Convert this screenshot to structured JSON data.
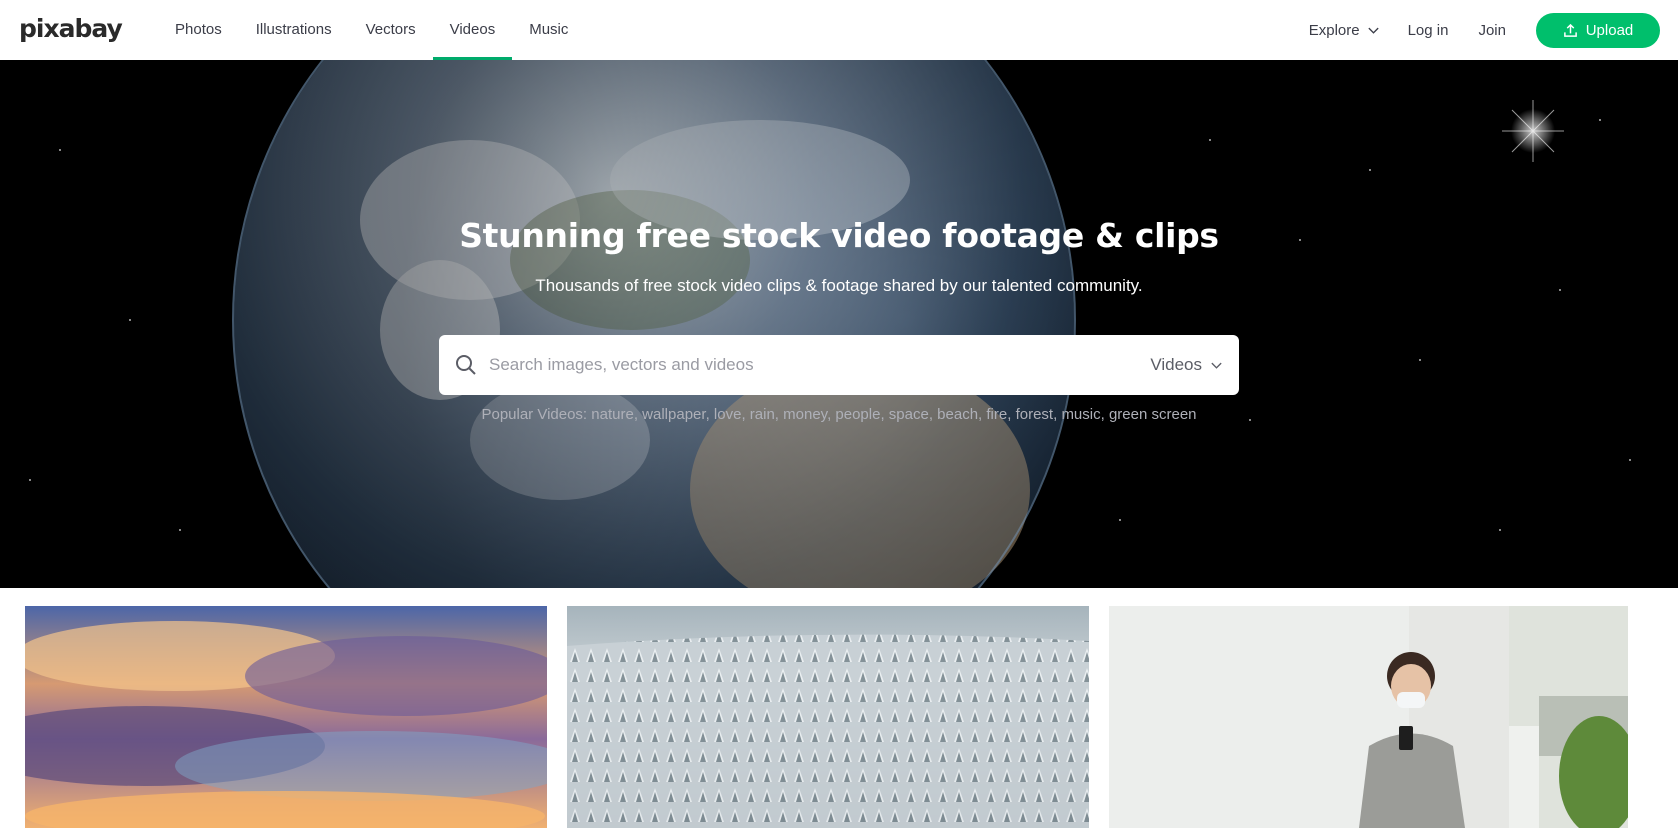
{
  "logo": "pixabay",
  "nav": [
    {
      "label": "Photos",
      "active": false
    },
    {
      "label": "Illustrations",
      "active": false
    },
    {
      "label": "Vectors",
      "active": false
    },
    {
      "label": "Videos",
      "active": true
    },
    {
      "label": "Music",
      "active": false
    }
  ],
  "right_nav": {
    "explore": "Explore",
    "login": "Log in",
    "join": "Join",
    "upload": "Upload"
  },
  "hero": {
    "title": "Stunning free stock video footage & clips",
    "subtitle": "Thousands of free stock video clips & footage shared by our talented community."
  },
  "search": {
    "placeholder": "Search images, vectors and videos",
    "type": "Videos"
  },
  "popular": {
    "label": "Popular Videos:",
    "tags": [
      "nature",
      "wallpaper",
      "love",
      "rain",
      "money",
      "people",
      "space",
      "beach",
      "fire",
      "forest",
      "music",
      "green screen"
    ]
  },
  "colors": {
    "accent": "#00bf6c",
    "active_underline": "#00ab6b"
  },
  "icons": {
    "explore": "chevron-down-icon",
    "upload": "upload-icon",
    "search": "search-icon",
    "search_type": "chevron-down-icon"
  }
}
